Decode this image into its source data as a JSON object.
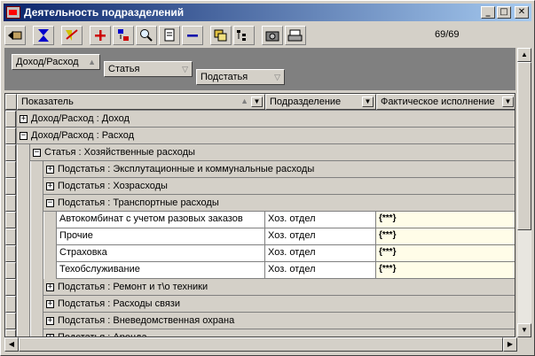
{
  "window": {
    "title": "Деятельность подразделений",
    "min_glyph": "_",
    "max_glyph": "□",
    "close_glyph": "✕"
  },
  "toolbar": {
    "icons": [
      "back-icon",
      "filter-icon",
      "sort-icon",
      "add-icon",
      "copy-row-icon",
      "find-icon",
      "export-icon",
      "delete-icon",
      "folders-icon",
      "structure-icon",
      "camera-icon",
      "print-icon"
    ],
    "counter": "69/69"
  },
  "group_by": {
    "level1": "Доход/Расход",
    "level2": "Статья",
    "level3": "Подстатья"
  },
  "columns": {
    "indicator": "Показатель",
    "department": "Подразделение",
    "actual": "Фактическое исполнение"
  },
  "rows": [
    {
      "type": "group",
      "level": 0,
      "expanded": false,
      "label": "Доход/Расход : Доход"
    },
    {
      "type": "group",
      "level": 0,
      "expanded": true,
      "label": "Доход/Расход : Расход"
    },
    {
      "type": "group",
      "level": 1,
      "expanded": true,
      "label": "Статья : Хозяйственные расходы"
    },
    {
      "type": "group",
      "level": 2,
      "expanded": false,
      "label": "Подстатья : Эксплутационные и коммунальные расходы"
    },
    {
      "type": "group",
      "level": 2,
      "expanded": false,
      "label": "Подстатья : Хозрасходы"
    },
    {
      "type": "group",
      "level": 2,
      "expanded": true,
      "label": "Подстатья : Транспортные расходы"
    },
    {
      "type": "data",
      "indicator": "Автокомбинат с учетом  разовых заказов",
      "department": "Хоз. отдел",
      "actual": "{***}"
    },
    {
      "type": "data",
      "indicator": "Прочие",
      "department": "Хоз. отдел",
      "actual": "{***}"
    },
    {
      "type": "data",
      "indicator": "Страховка",
      "department": "Хоз. отдел",
      "actual": "{***}"
    },
    {
      "type": "data",
      "indicator": "Техобслуживание",
      "department": "Хоз. отдел",
      "actual": "{***}"
    },
    {
      "type": "group",
      "level": 2,
      "expanded": false,
      "label": "Подстатья : Ремонт и т\\о техники"
    },
    {
      "type": "group",
      "level": 2,
      "expanded": false,
      "label": "Подстатья : Расходы связи"
    },
    {
      "type": "group",
      "level": 2,
      "expanded": false,
      "label": "Подстатья : Вневедомственная охрана"
    },
    {
      "type": "group",
      "level": 2,
      "expanded": false,
      "label": "Подстатья : Аренда"
    }
  ],
  "colors": {
    "title_start": "#0a246a",
    "title_end": "#a6caf0",
    "plus_red": "#cc0000",
    "minus_blue": "#0000aa"
  }
}
